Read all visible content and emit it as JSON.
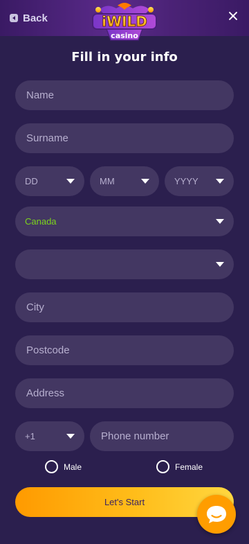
{
  "header": {
    "back_label": "Back",
    "logo_top": "iWILD",
    "logo_bottom": "casino"
  },
  "form": {
    "title": "Fill in your info",
    "name_placeholder": "Name",
    "surname_placeholder": "Surname",
    "day_label": "DD",
    "month_label": "MM",
    "year_label": "YYYY",
    "country_value": "Canada",
    "province_value": "",
    "city_placeholder": "City",
    "postcode_placeholder": "Postcode",
    "address_placeholder": "Address",
    "phone_code": "+1",
    "phone_placeholder": "Phone number",
    "gender_male": "Male",
    "gender_female": "Female",
    "submit_label": "Let's Start"
  },
  "colors": {
    "background": "#2b1f4e",
    "field": "#433762",
    "accent_orange": "#ff9d00",
    "country_text": "#7cd41c"
  },
  "icons": {
    "back": "back-arrow-icon",
    "close": "close-icon",
    "dropdown": "chevron-down-icon",
    "chat": "chat-bubble-icon"
  }
}
